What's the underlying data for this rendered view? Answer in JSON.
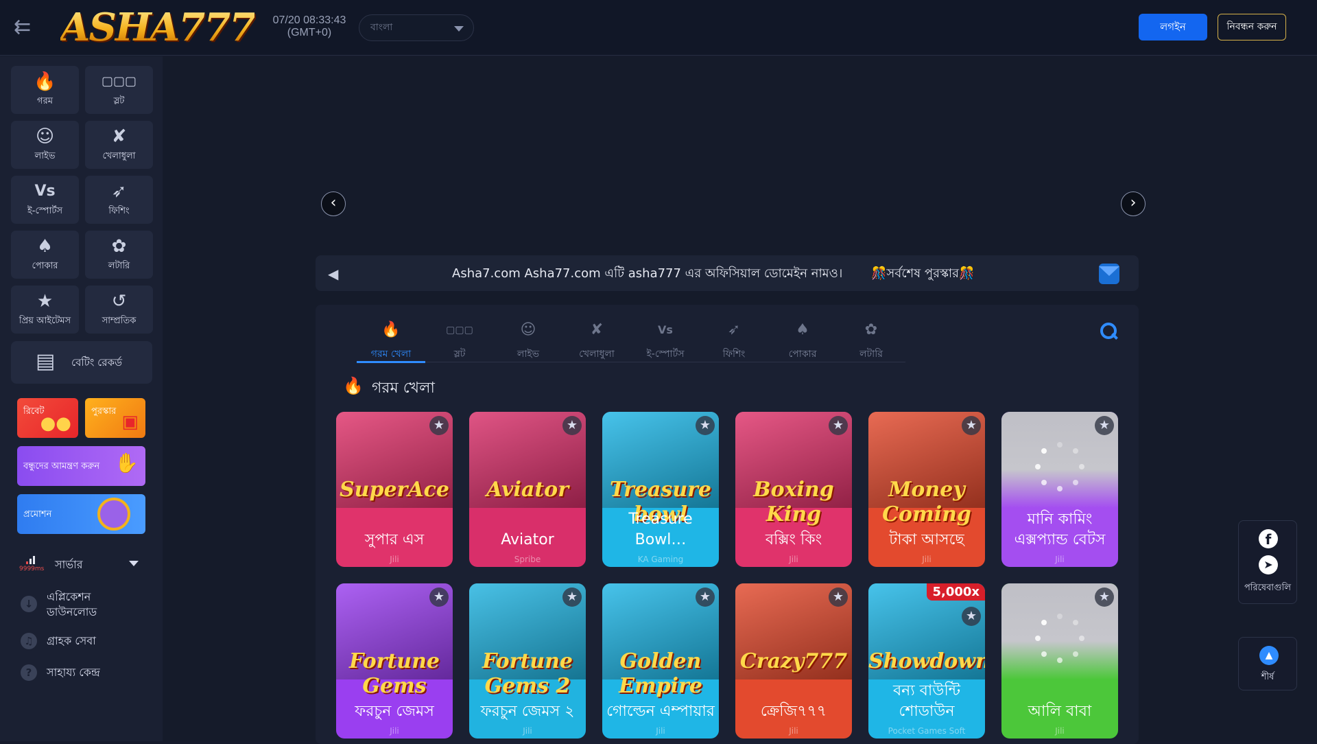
{
  "header": {
    "logo_text": "ASHA777",
    "datetime": "07/20 08:33:43",
    "timezone": "(GMT+0)",
    "language": "বাংলা",
    "login_label": "লগইন",
    "register_label": "নিবন্ধন করুন"
  },
  "sidebar": {
    "categories": [
      {
        "label": "গরম",
        "icon": "flame-icon"
      },
      {
        "label": "স্লট",
        "icon": "slot-machine-icon"
      },
      {
        "label": "লাইভ",
        "icon": "live-dealer-icon"
      },
      {
        "label": "খেলাধুলা",
        "icon": "sports-icon"
      },
      {
        "label": "ই-স্পোর্টস",
        "icon": "esports-vs-icon"
      },
      {
        "label": "ফিশিং",
        "icon": "fish-icon"
      },
      {
        "label": "পোকার",
        "icon": "poker-cards-icon"
      },
      {
        "label": "লটারি",
        "icon": "lottery-icon"
      },
      {
        "label": "প্রিয় আইটেমস",
        "icon": "star-icon"
      },
      {
        "label": "সাম্প্রতিক",
        "icon": "history-icon"
      }
    ],
    "betting_record": "বেটিং রেকর্ড",
    "promos": {
      "rebate": "রিবেট",
      "reward": "পুরস্কার",
      "invite": "বন্ধুদের আমন্ত্রণ করুন",
      "promotion": "প্রমোশন"
    },
    "server": {
      "label": "সার্ভার",
      "latency": "9999ms"
    },
    "links": {
      "app_download": "এপ্লিকেশন ডাউনলোড",
      "customer_service": "গ্রাহক সেবা",
      "help_center": "সাহায্য কেন্দ্র"
    }
  },
  "carousel": {
    "dot_count": 6,
    "active_index": 0
  },
  "marquee": {
    "text": "Asha7.com Asha77.com এটি asha777 এর অফিসিয়াল ডোমেইন নামও।",
    "text2": "🎊সর্বশেষ পুরস্কার🎊"
  },
  "game_tabs": [
    {
      "label": "গরম খেলা",
      "icon": "flame-icon",
      "active": true
    },
    {
      "label": "স্লট",
      "icon": "slot-machine-icon"
    },
    {
      "label": "লাইভ",
      "icon": "live-dealer-icon"
    },
    {
      "label": "খেলাধুলা",
      "icon": "sports-icon"
    },
    {
      "label": "ই-স্পোর্টস",
      "icon": "esports-vs-icon"
    },
    {
      "label": "ফিশিং",
      "icon": "fish-icon"
    },
    {
      "label": "পোকার",
      "icon": "poker-cards-icon"
    },
    {
      "label": "লটারি",
      "icon": "lottery-icon"
    }
  ],
  "section": {
    "title": "গরম খেলা"
  },
  "games": [
    {
      "name": "সুপার এস",
      "provider": "Jili",
      "art_title": "SuperAce",
      "color": "#e0336b"
    },
    {
      "name": "Aviator",
      "provider": "Spribe",
      "art_title": "Aviator",
      "color": "#d92f6a"
    },
    {
      "name": "Treasure Bowl…",
      "provider": "KA Gaming",
      "art_title": "Treasure bowl",
      "color": "#1fb6e6"
    },
    {
      "name": "বক্সিং কিং",
      "provider": "Jili",
      "art_title": "Boxing King",
      "color": "#e0336b"
    },
    {
      "name": "টাকা আসছে",
      "provider": "Jili",
      "art_title": "Money Coming",
      "color": "#e34a2e"
    },
    {
      "name": "মানি কামিং এক্সপ্যান্ড বেটস",
      "provider": "Jili",
      "art_title": "",
      "color": "#a44ef0"
    },
    {
      "name": "ফরচুন জেমস",
      "provider": "Jili",
      "art_title": "Fortune Gems",
      "color": "#9a3ff0"
    },
    {
      "name": "ফরচুন জেমস ২",
      "provider": "Jili",
      "art_title": "Fortune Gems 2",
      "color": "#21b3e0"
    },
    {
      "name": "গোল্ডেন এম্পায়ার",
      "provider": "Jili",
      "art_title": "Golden Empire",
      "color": "#1fb6e6"
    },
    {
      "name": "ক্রেজি৭৭৭",
      "provider": "Jili",
      "art_title": "Crazy777",
      "color": "#e34a2e"
    },
    {
      "name": "বন্য বাউন্টি শোডাউন",
      "provider": "Pocket Games Soft",
      "art_title": "Showdown",
      "badge": "5,000x",
      "color": "#1fb6e6"
    },
    {
      "name": "আলি বাবা",
      "provider": "Jili",
      "art_title": "",
      "color": "#4cc73a"
    }
  ],
  "float": {
    "social_label": "পরিষেবাগুলি",
    "top_label": "শীর্ষ"
  }
}
